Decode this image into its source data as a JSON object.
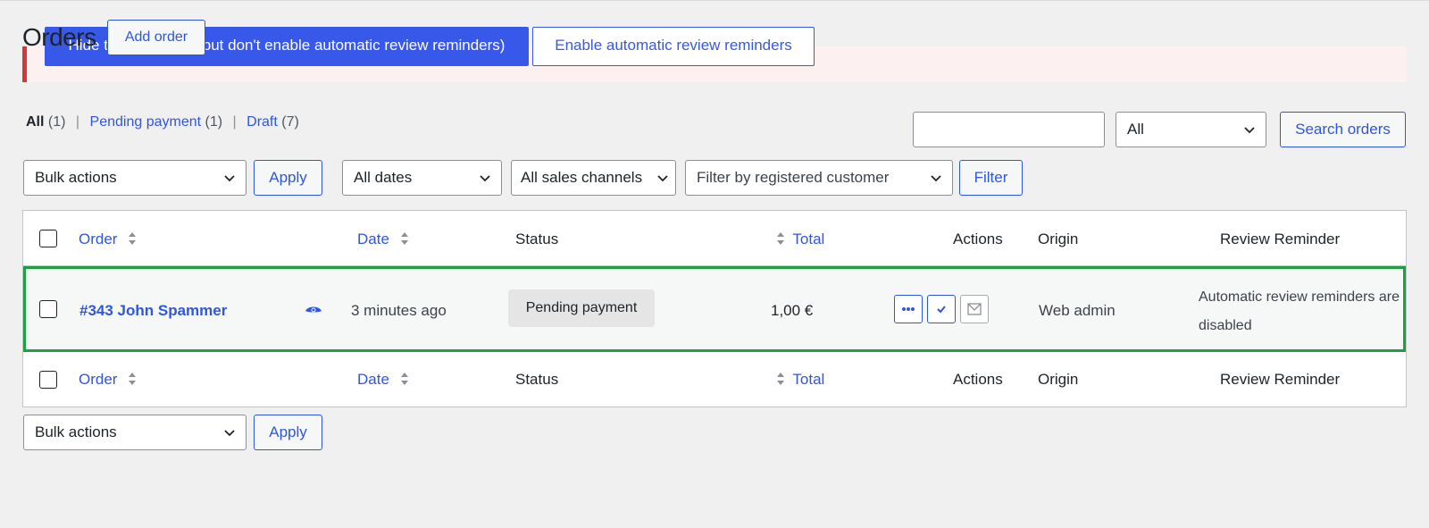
{
  "notice": {
    "hide_label": "Hide this message (but don't enable automatic review reminders)",
    "enable_label": "Enable automatic review reminders"
  },
  "header": {
    "title": "Orders",
    "add_order_label": "Add order"
  },
  "views": [
    {
      "label": "All",
      "count": "(1)"
    },
    {
      "label": "Pending payment",
      "count": "(1)"
    },
    {
      "label": "Draft",
      "count": "(7)"
    }
  ],
  "search": {
    "status_select": "All",
    "button_label": "Search orders"
  },
  "filters": {
    "bulk_actions": "Bulk actions",
    "apply_label": "Apply",
    "dates": "All dates",
    "channels": "All sales channels",
    "customer": "Filter by registered customer",
    "filter_label": "Filter"
  },
  "columns": {
    "order": "Order",
    "date": "Date",
    "status": "Status",
    "total": "Total",
    "actions": "Actions",
    "origin": "Origin",
    "review": "Review Reminder"
  },
  "row": {
    "order": "#343 John Spammer",
    "date": "3 minutes ago",
    "status": "Pending payment",
    "total": "1,00 €",
    "origin": "Web admin",
    "review": "Automatic review reminders are disabled"
  },
  "icons": {
    "sort": "sort-arrows-icon",
    "preview": "eye-icon",
    "more": "ellipsis-icon",
    "complete": "check-icon",
    "email": "envelope-icon",
    "dropdown": "chevron-down-icon"
  },
  "colors": {
    "accent": "#2f56e0",
    "highlight_border": "#1e9e45",
    "notice_border": "#d63638"
  }
}
